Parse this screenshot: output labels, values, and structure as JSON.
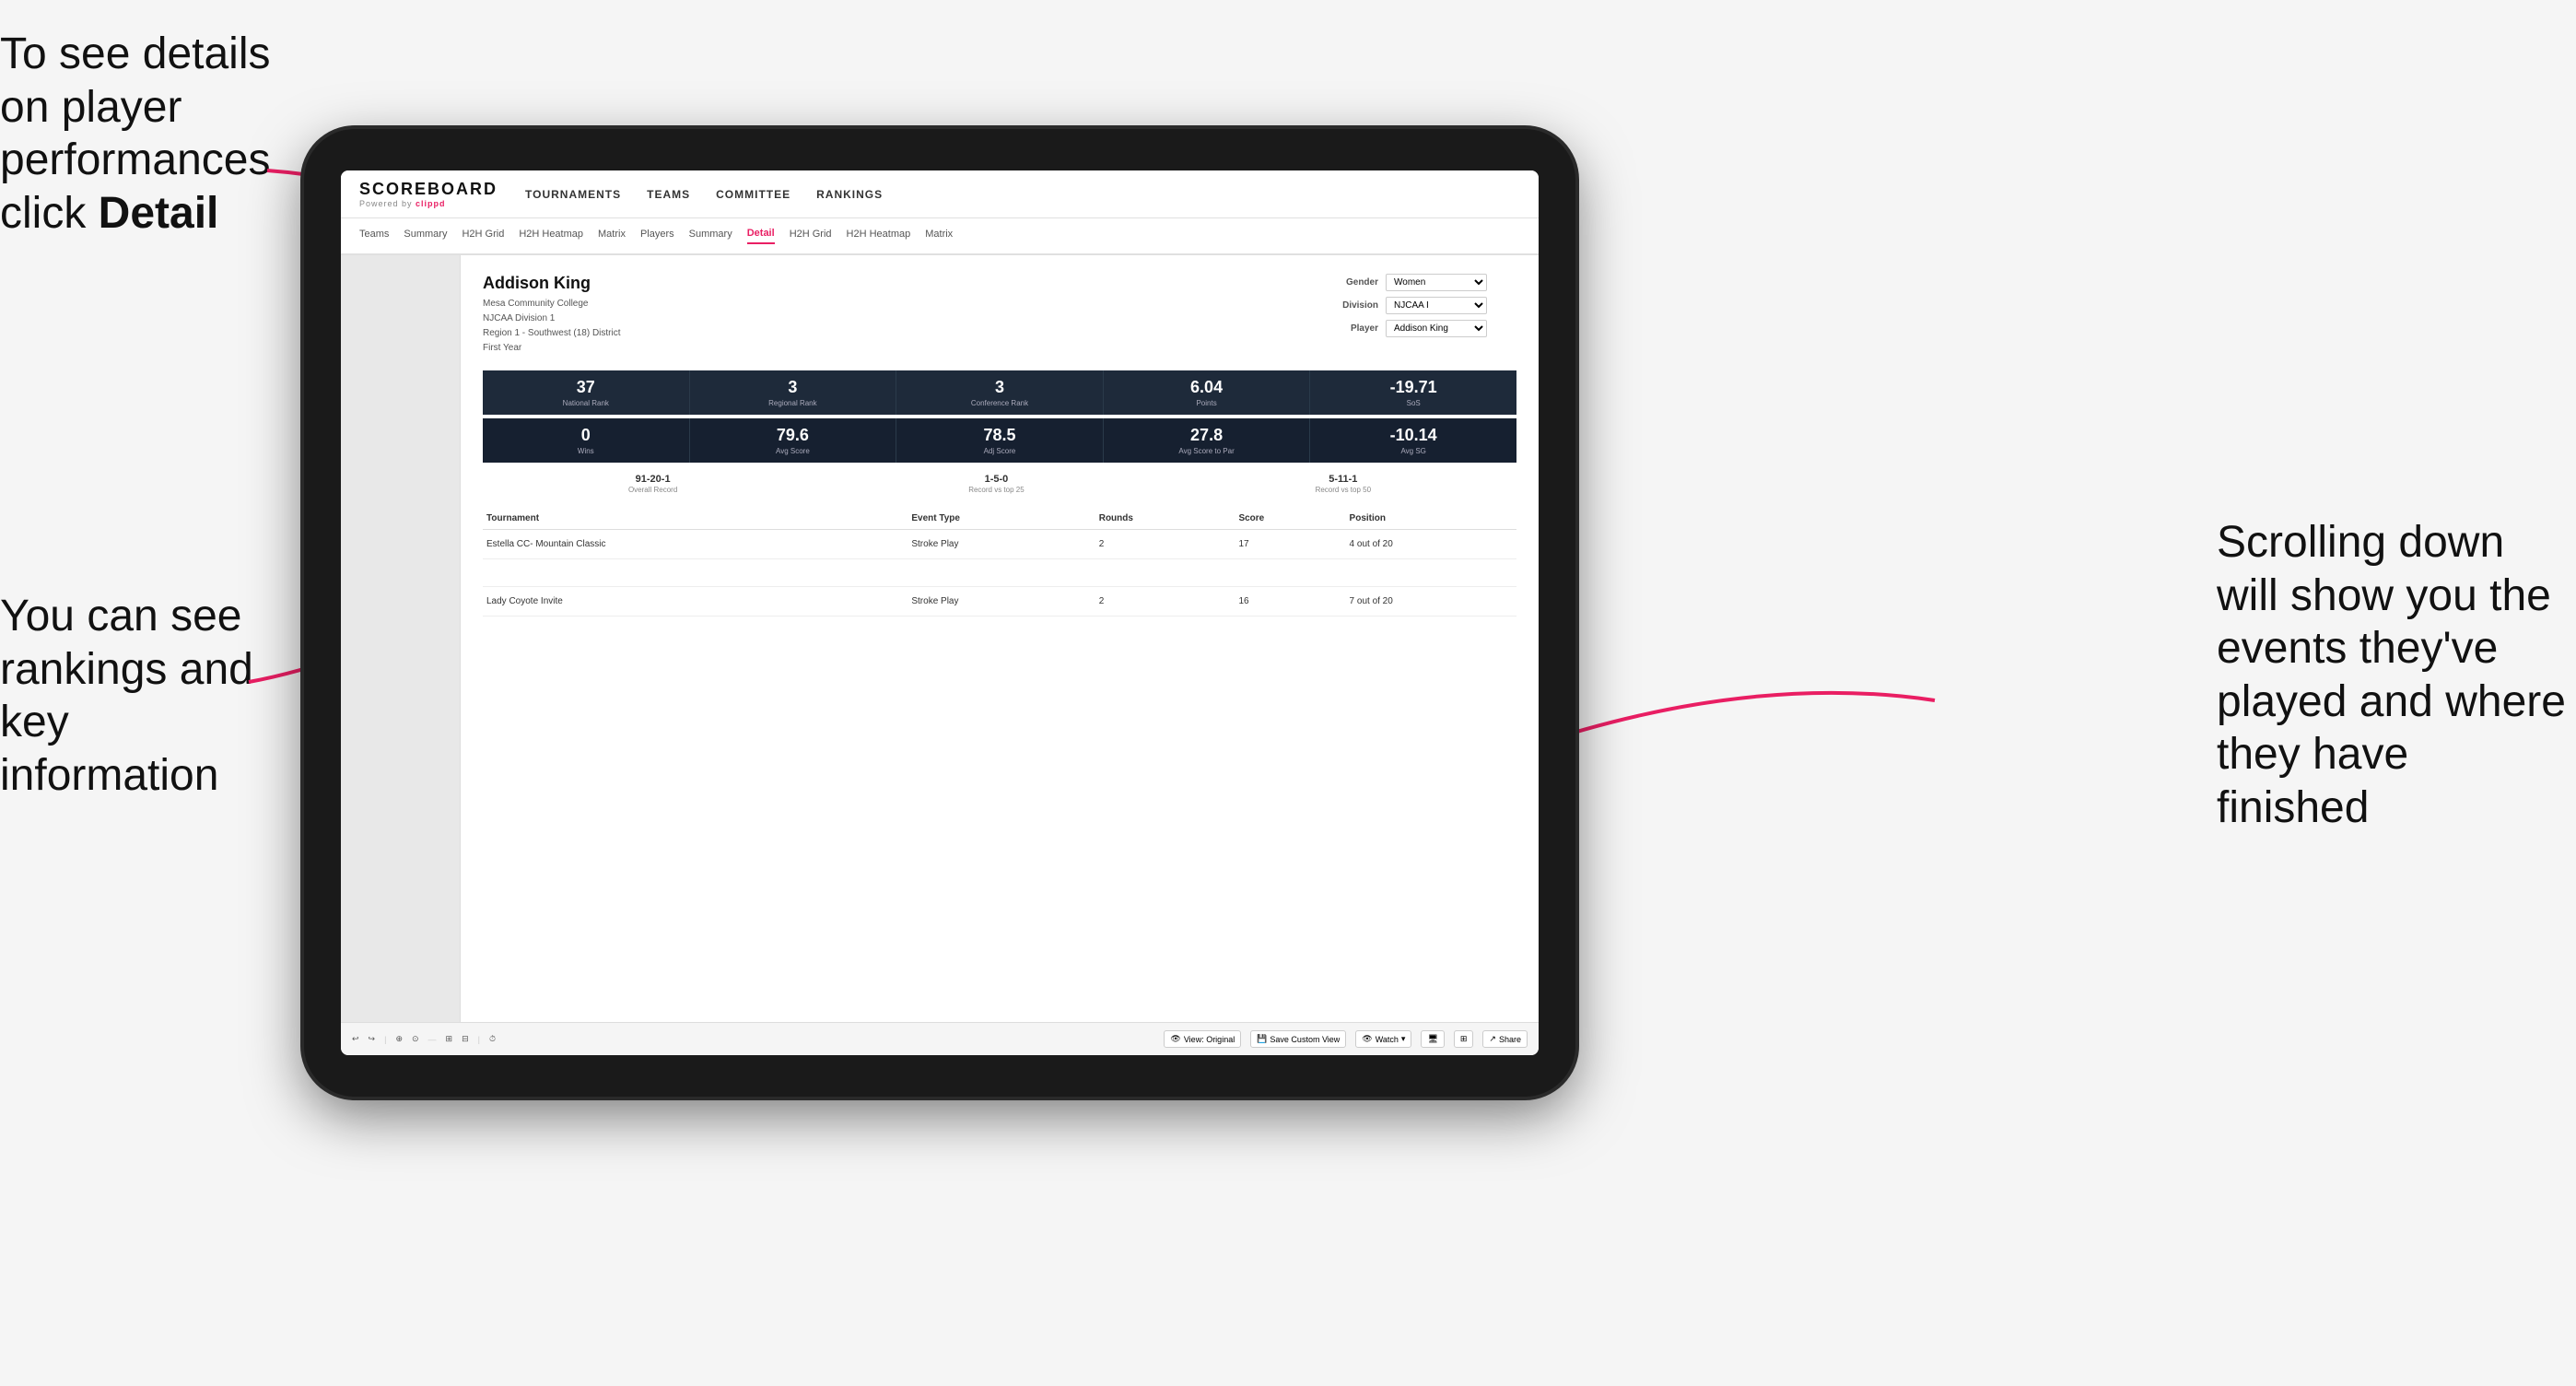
{
  "annotations": {
    "left_title": "To see details on player performances click ",
    "left_bold": "Detail",
    "right_text": "Scrolling down will show you the events they've played and where they have finished",
    "bottom_left": "You can see rankings and key information"
  },
  "nav": {
    "logo": "SCOREBOARD",
    "powered_by": "Powered by ",
    "clippd": "clippd",
    "main_items": [
      "TOURNAMENTS",
      "TEAMS",
      "COMMITTEE",
      "RANKINGS"
    ],
    "sub_items": [
      "Teams",
      "Summary",
      "H2H Grid",
      "H2H Heatmap",
      "Matrix",
      "Players",
      "Summary",
      "Detail",
      "H2H Grid",
      "H2H Heatmap",
      "Matrix"
    ],
    "active_tab": "Detail"
  },
  "player": {
    "name": "Addison King",
    "college": "Mesa Community College",
    "division": "NJCAA Division 1",
    "region": "Region 1 - Southwest (18) District",
    "year": "First Year"
  },
  "filters": {
    "gender_label": "Gender",
    "gender_value": "Women",
    "division_label": "Division",
    "division_value": "NJCAA I",
    "player_label": "Player",
    "player_value": "Addison King"
  },
  "stats_row1": [
    {
      "value": "37",
      "label": "National Rank"
    },
    {
      "value": "3",
      "label": "Regional Rank"
    },
    {
      "value": "3",
      "label": "Conference Rank"
    },
    {
      "value": "6.04",
      "label": "Points"
    },
    {
      "value": "-19.71",
      "label": "SoS"
    }
  ],
  "stats_row2": [
    {
      "value": "0",
      "label": "Wins"
    },
    {
      "value": "79.6",
      "label": "Avg Score"
    },
    {
      "value": "78.5",
      "label": "Adj Score"
    },
    {
      "value": "27.8",
      "label": "Avg Score to Par"
    },
    {
      "value": "-10.14",
      "label": "Avg SG"
    }
  ],
  "records": [
    {
      "value": "91-20-1",
      "label": "Overall Record"
    },
    {
      "value": "1-5-0",
      "label": "Record vs top 25"
    },
    {
      "value": "5-11-1",
      "label": "Record vs top 50"
    }
  ],
  "table": {
    "headers": [
      "Tournament",
      "Event Type",
      "Rounds",
      "Score",
      "Position"
    ],
    "rows": [
      {
        "tournament": "Estella CC- Mountain Classic",
        "event_type": "Stroke Play",
        "rounds": "2",
        "score": "17",
        "position": "4 out of 20"
      },
      {
        "tournament": "",
        "event_type": "",
        "rounds": "",
        "score": "",
        "position": ""
      },
      {
        "tournament": "Lady Coyote Invite",
        "event_type": "Stroke Play",
        "rounds": "2",
        "score": "16",
        "position": "7 out of 20"
      }
    ]
  },
  "toolbar": {
    "view_original": "View: Original",
    "save_custom": "Save Custom View",
    "watch": "Watch",
    "share": "Share"
  }
}
